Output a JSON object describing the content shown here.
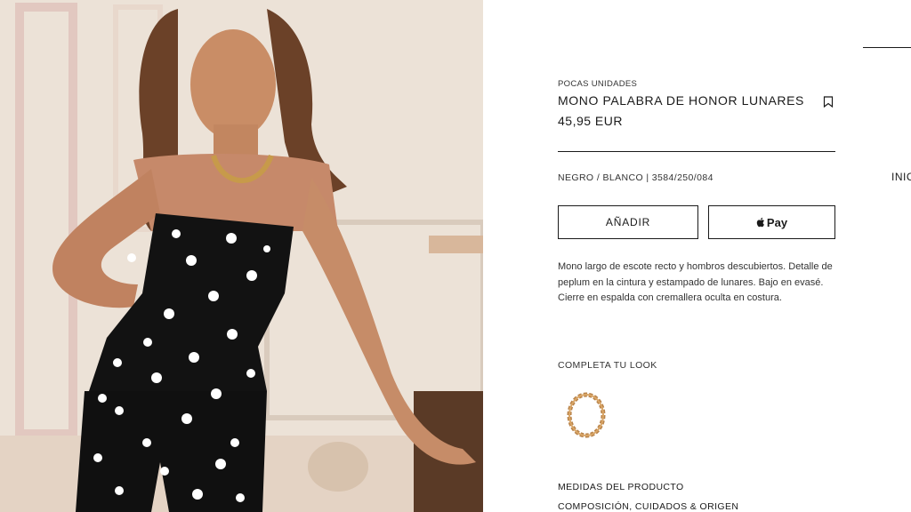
{
  "product": {
    "stock_label": "POCAS UNIDADES",
    "title": "MONO PALABRA DE HONOR LUNARES",
    "price": "45,95 EUR",
    "color_ref": "NEGRO / BLANCO | 3584/250/084",
    "description": "Mono largo de escote recto y hombros descubiertos. Detalle de peplum en la cintura y estampado de lunares. Bajo en evasé. Cierre en espalda con cremallera oculta en costura."
  },
  "actions": {
    "add_label": "AÑADIR",
    "pay_label": "Pay"
  },
  "look": {
    "label": "COMPLETA TU LOOK",
    "item_icon": "chain-necklace"
  },
  "sections": {
    "measures": "MEDIDAS DEL PRODUCTO",
    "composition": "COMPOSICIÓN, CUIDADOS & ORIGEN"
  },
  "side_nav": {
    "partial_label": "INIC"
  },
  "colors": {
    "text": "#1a1a1a",
    "border": "#1a1a1a",
    "background": "#ffffff"
  }
}
